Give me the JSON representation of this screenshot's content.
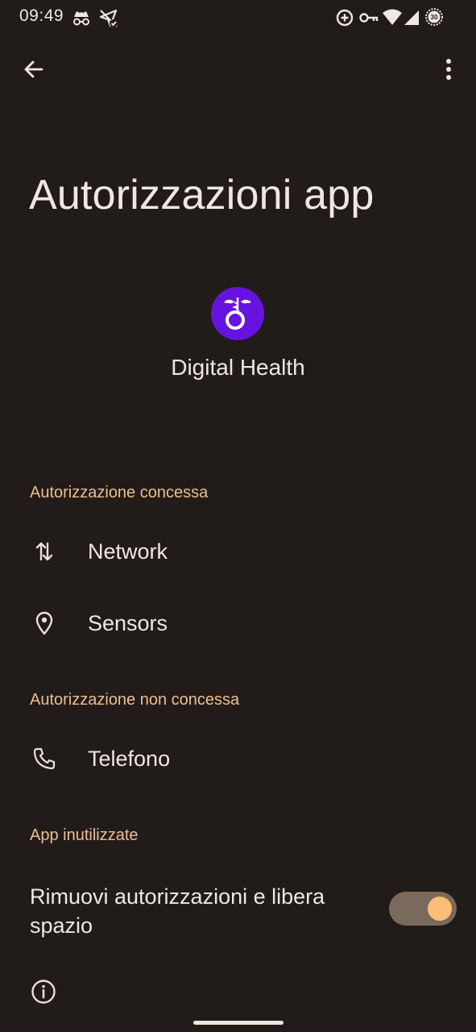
{
  "status_bar": {
    "time": "09:49",
    "icons": [
      "incognito-icon",
      "location-off-icon",
      "data-saver-icon",
      "vpn-key-icon",
      "wifi-icon",
      "signal-icon",
      "battery-saver-icon"
    ],
    "battery_badge": "30"
  },
  "app_bar": {
    "back_icon": "arrow-back-icon",
    "more_icon": "more-vert-icon"
  },
  "page": {
    "title": "Autorizzazioni app"
  },
  "app": {
    "name": "Digital Health",
    "icon": "caduceus-ring-icon",
    "icon_bg": "#6713e0"
  },
  "sections": {
    "granted": {
      "header": "Autorizzazione concessa",
      "items": [
        {
          "label": "Network",
          "icon": "swap-vert-icon"
        },
        {
          "label": "Sensors",
          "icon": "location-pin-icon"
        }
      ]
    },
    "denied": {
      "header": "Autorizzazione non concessa",
      "items": [
        {
          "label": "Telefono",
          "icon": "phone-icon"
        }
      ]
    },
    "unused": {
      "header": "App inutilizzate",
      "toggle_label": "Rimuovi autorizzazioni e libera spazio",
      "toggle_on": true
    }
  },
  "colors": {
    "background": "#211c1a",
    "accent": "#f0bd8d",
    "toggle_thumb": "#ffbc79",
    "toggle_track": "#7a6a5c"
  }
}
